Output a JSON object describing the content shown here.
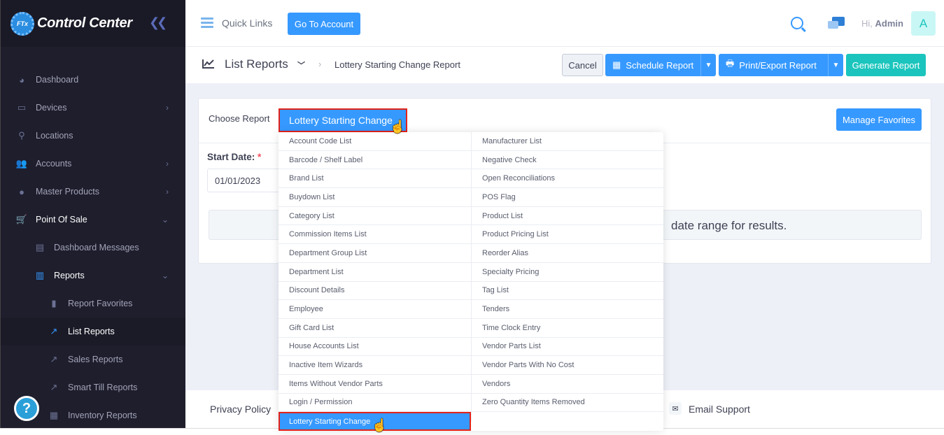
{
  "brand": {
    "logo_badge": "FTx",
    "name": "Control Center"
  },
  "sidebar": {
    "items": [
      {
        "label": "Dashboard",
        "icon": "dashboard-icon"
      },
      {
        "label": "Devices",
        "icon": "devices-icon"
      },
      {
        "label": "Locations",
        "icon": "location-pin-icon"
      },
      {
        "label": "Accounts",
        "icon": "users-icon"
      },
      {
        "label": "Master Products",
        "icon": "products-icon"
      },
      {
        "label": "Point Of Sale",
        "icon": "cart-icon"
      },
      {
        "label": "Dashboard Messages",
        "icon": "messages-icon"
      },
      {
        "label": "Reports",
        "icon": "bar-chart-icon"
      },
      {
        "label": "Report Favorites",
        "icon": "bookmark-icon"
      },
      {
        "label": "List Reports",
        "icon": "line-chart-icon"
      },
      {
        "label": "Sales Reports",
        "icon": "line-chart-icon"
      },
      {
        "label": "Smart Till Reports",
        "icon": "line-chart-icon"
      },
      {
        "label": "Inventory Reports",
        "icon": "inventory-icon"
      }
    ],
    "help": "?"
  },
  "topbar": {
    "quick_links": "Quick Links",
    "go_to_account": "Go To Account",
    "greeting": "Hi,",
    "user": "Admin",
    "avatar_letter": "A"
  },
  "subheader": {
    "title": "List Reports",
    "breadcrumb": "Lottery Starting Change Report",
    "cancel": "Cancel",
    "schedule": "Schedule Report",
    "print_export": "Print/Export Report",
    "generate": "Generate Report"
  },
  "card": {
    "choose_label": "Choose Report",
    "selected_report": "Lottery Starting Change",
    "manage_favorites": "Manage Favorites",
    "start_date_label": "Start Date:",
    "required_mark": "*",
    "start_date_value": "01/01/2023",
    "info_partial": "date range for results."
  },
  "menu": {
    "col1": [
      "Account Code List",
      "Barcode / Shelf Label",
      "Brand List",
      "Buydown List",
      "Category List",
      "Commission Items List",
      "Department Group List",
      "Department List",
      "Discount Details",
      "Employee",
      "Gift Card List",
      "House Accounts List",
      "Inactive Item Wizards",
      "Items Without Vendor Parts",
      "Login / Permission",
      "Lottery Starting Change"
    ],
    "col2": [
      "Manufacturer List",
      "Negative Check",
      "Open Reconciliations",
      "POS Flag",
      "Product List",
      "Product Pricing List",
      "Reorder Alias",
      "Specialty Pricing",
      "Tag List",
      "Tenders",
      "Time Clock Entry",
      "Vendor Parts List",
      "Vendor Parts With No Cost",
      "Vendors",
      "Zero Quantity Items Removed"
    ]
  },
  "footer": {
    "privacy": "Privacy Policy",
    "email_support": "Email Support"
  },
  "colors": {
    "primary": "#3699ff",
    "success": "#1bc5bd",
    "sidebar_bg": "#1e1e2d",
    "highlight_border": "#e2231a"
  }
}
